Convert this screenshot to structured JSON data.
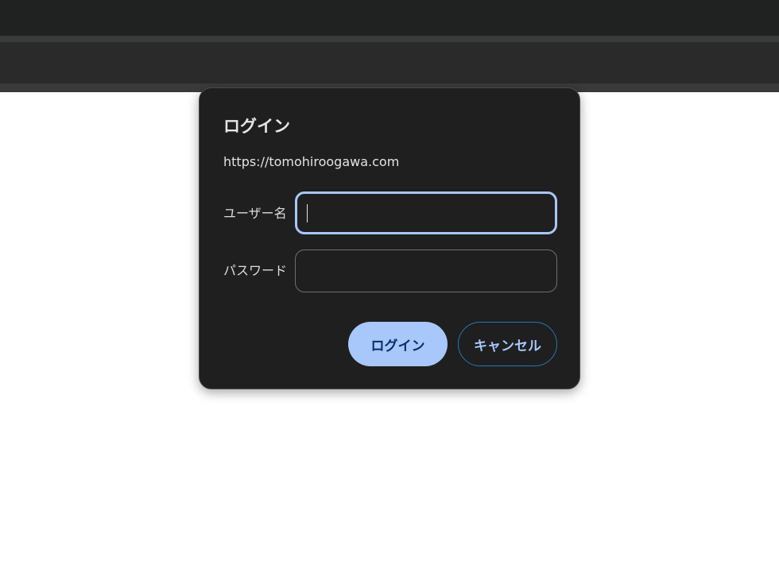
{
  "dialog": {
    "title": "ログイン",
    "origin": "https://tomohiroogawa.com",
    "username_label": "ユーザー名",
    "username_value": "",
    "password_label": "パスワード",
    "password_value": "",
    "login_button": "ログイン",
    "cancel_button": "キャンセル"
  },
  "colors": {
    "accent": "#a8c7fa",
    "dialog_bg": "#1f1f1f",
    "page_bg": "#ffffff",
    "chrome_bg": "#2a2a2a"
  }
}
